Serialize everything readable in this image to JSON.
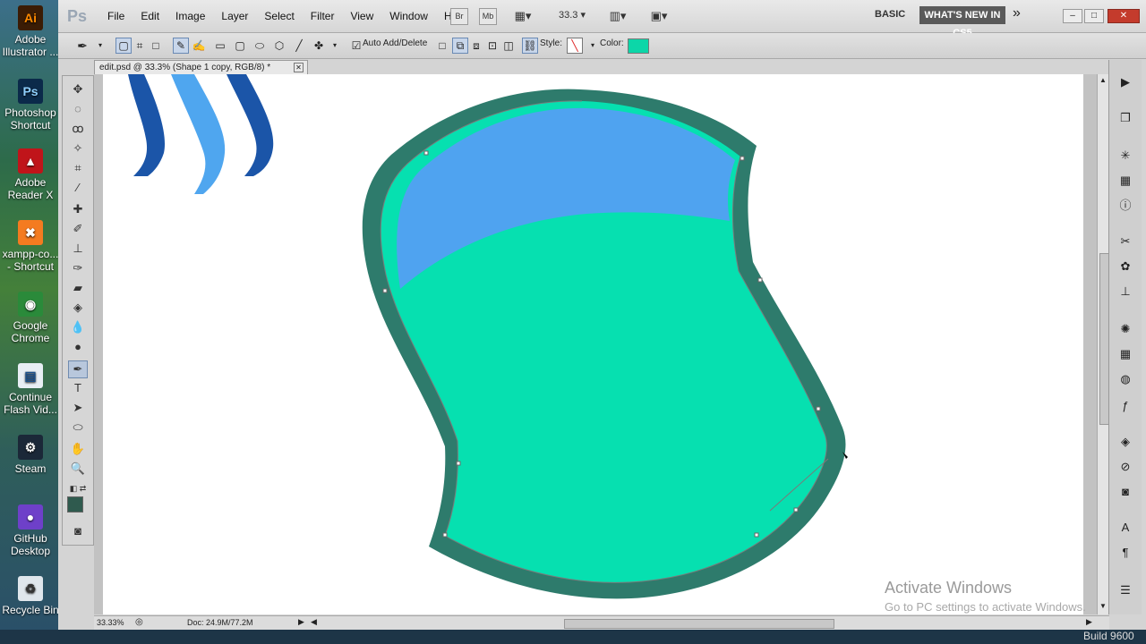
{
  "desktop": {
    "icons": [
      {
        "label": "Adobe Illustrator ...",
        "glyph": "Ai",
        "color": "#ff8a00",
        "bg": "#3b1c05"
      },
      {
        "label": "Photoshop Shortcut",
        "glyph": "Ps",
        "color": "#8fd0ff",
        "bg": "#0b2a4a"
      },
      {
        "label": "Adobe Reader X",
        "glyph": "▲",
        "color": "#fff",
        "bg": "#c0141a"
      },
      {
        "label": "xampp-co... - Shortcut",
        "glyph": "✖",
        "color": "#fff",
        "bg": "#f47b20"
      },
      {
        "label": "Google Chrome",
        "glyph": "◉",
        "color": "#fff",
        "bg": "#2a8a3a"
      },
      {
        "label": "Continue Flash Vid...",
        "glyph": "▤",
        "color": "#1a4f8a",
        "bg": "#e8eef4"
      },
      {
        "label": "Steam",
        "glyph": "⚙",
        "color": "#fff",
        "bg": "#1b2838"
      },
      {
        "label": "GitHub Desktop",
        "glyph": "●",
        "color": "#fff",
        "bg": "#6e40c9"
      },
      {
        "label": "Recycle Bin",
        "glyph": "♻",
        "color": "#333",
        "bg": "#dfe6ec"
      }
    ]
  },
  "app": {
    "logo": "Ps",
    "menus": [
      "File",
      "Edit",
      "Image",
      "Layer",
      "Select",
      "Filter",
      "View",
      "Window",
      "Help"
    ],
    "bridge_btn": "Br",
    "minibridge_btn": "Mb",
    "zoom_value": "33.3",
    "workspace": "BASIC",
    "whats_new": "WHAT'S NEW IN CS5",
    "more": "»",
    "win_min": "–",
    "win_max": "□",
    "win_close": "✕"
  },
  "options": {
    "auto_add_label": "Auto Add/Delete",
    "auto_add_checked": true,
    "style_label": "Style:",
    "color_label": "Color:",
    "color_value": "#0cd6a8"
  },
  "document": {
    "tab_title": "edit.psd @ 33.3% (Shape 1 copy, RGB/8) *",
    "close": "✕",
    "zoom_status": "33.33%",
    "doc_size": "Doc: 24.9M/77.2M"
  },
  "artwork": {
    "outer_color": "#2e7b6c",
    "inner_color": "#06e0b0",
    "highlight_color": "#4fa3f0",
    "stripe_dark": "#1b55a8",
    "stripe_light": "#4fa6ef"
  },
  "watermark": {
    "title": "Activate Windows",
    "subtitle": "Go to PC settings to activate Windows."
  },
  "taskbar": {
    "build": "Build 9600"
  }
}
